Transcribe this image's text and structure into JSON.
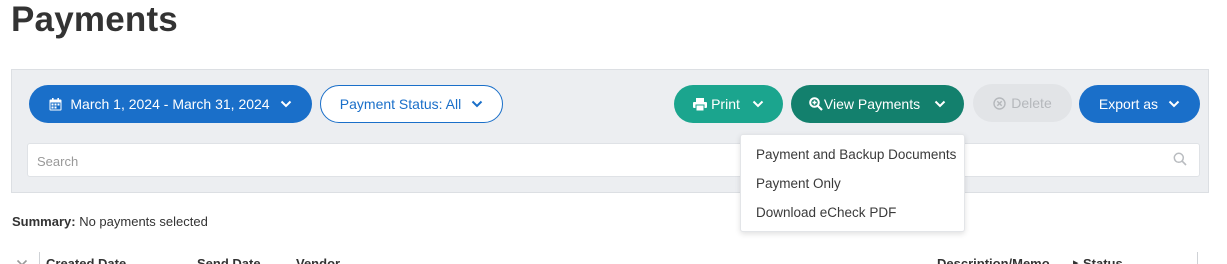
{
  "page": {
    "title": "Payments"
  },
  "toolbar": {
    "date_range": "March 1, 2024 - March 31, 2024",
    "payment_status": "Payment Status: All",
    "print": "Print",
    "view_payments": "View Payments",
    "delete": "Delete",
    "export": "Export as"
  },
  "search": {
    "placeholder": "Search",
    "value": ""
  },
  "view_payments_menu": {
    "items": [
      {
        "label": "Payment and Backup Documents"
      },
      {
        "label": "Payment Only"
      },
      {
        "label": "Download eCheck PDF"
      }
    ]
  },
  "summary": {
    "label": "Summary:",
    "text": "No payments selected"
  },
  "table": {
    "columns": [
      {
        "label": "Created Date"
      },
      {
        "label": "Send Date"
      },
      {
        "label": "Vendor"
      },
      {
        "label": "Description/Memo"
      },
      {
        "label": "Status"
      }
    ]
  },
  "colors": {
    "primary_blue": "#1a6fc9",
    "print_green": "#1ba58e",
    "view_teal": "#13806d",
    "disabled_gray": "#e2e4e7",
    "panel_bg": "#eceef1"
  },
  "icons": {
    "date": "calendar-icon",
    "print": "printer-icon",
    "view": "magnifier-plus-icon",
    "delete": "circle-x-icon",
    "search": "search-icon",
    "dropdown": "chevron-down-icon"
  }
}
